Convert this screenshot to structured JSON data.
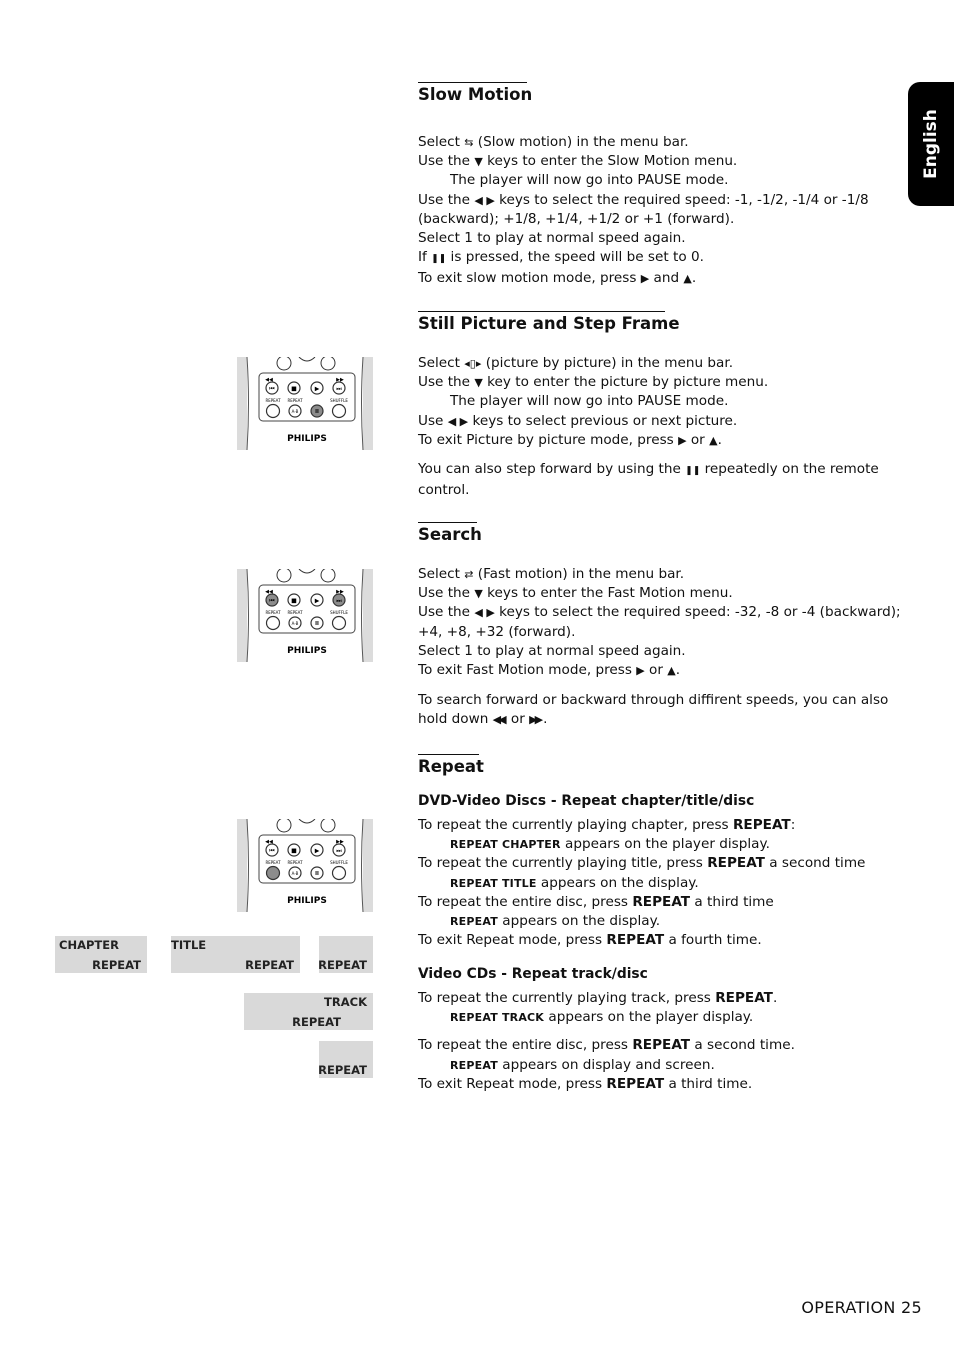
{
  "side_tab": {
    "label": "English"
  },
  "footer": {
    "label": "OPERATION 25"
  },
  "slow_motion": {
    "title": "Slow Motion",
    "lines": [
      {
        "pre": "Select ",
        "icon": "slow-motion-icon",
        "post": " (Slow motion) in the menu bar."
      },
      {
        "pre": "Use the ",
        "icon": "down-arrow-icon",
        "post": " keys to enter the Slow Motion menu."
      },
      {
        "text": "The player will now go into PAUSE mode.",
        "indent": true
      },
      {
        "pre": "Use the ",
        "icon": "left-right-arrows-icon",
        "post": " keys to select the required speed: -1, -1/2, -1/4 or -1/8 (backward); +1/8, +1/4, +1/2 or +1 (forward)."
      },
      {
        "text": "Select 1 to play at normal speed again."
      },
      {
        "pre": "If ",
        "icon": "pause-icon",
        "post": " is pressed, the speed will be set to 0."
      },
      {
        "pre": "To exit slow motion mode, press ",
        "icon": "play-icon",
        "mid": " and ",
        "icon2": "up-arrow-icon",
        "post": "."
      }
    ]
  },
  "still_picture": {
    "title": "Still Picture and Step Frame",
    "lines": [
      {
        "pre": "Select ",
        "icon": "picture-by-picture-icon",
        "post": " (picture by picture) in the menu bar."
      },
      {
        "pre": "Use the ",
        "icon": "down-arrow-icon",
        "post": " key to enter the picture by picture menu."
      },
      {
        "text": "The player will now go into PAUSE mode.",
        "indent": true
      },
      {
        "pre": "Use ",
        "icon": "left-right-arrows-icon",
        "post": " keys to select previous or next picture."
      },
      {
        "pre": "To exit Picture by picture mode, press ",
        "icon": "play-icon",
        "mid": "  or ",
        "icon2": "up-arrow-icon",
        "post": "."
      }
    ],
    "note": {
      "pre": "You can also step forward by using the ",
      "icon": "pause-icon",
      "post": " repeatedly on the remote control."
    }
  },
  "search": {
    "title": "Search",
    "lines": [
      {
        "pre": "Select ",
        "icon": "fast-motion-icon",
        "post": " (Fast motion) in the menu bar."
      },
      {
        "pre": "Use the ",
        "icon": "down-arrow-icon",
        "post": " keys to enter the Fast Motion menu."
      },
      {
        "pre": "Use the ",
        "icon": "left-right-arrows-icon",
        "post": " keys to select the required speed: -32, -8 or -4 (backward); +4, +8, +32 (forward)."
      },
      {
        "text": "Select 1 to play at normal speed again."
      },
      {
        "pre": "To exit Fast Motion mode, press ",
        "icon": "play-icon",
        "mid": "  or ",
        "icon2": "up-arrow-icon",
        "post": "."
      }
    ],
    "note": {
      "pre": "To search forward or backward through diffirent speeds, you can also hold down ",
      "icon": "rewind-icon",
      "mid": " or ",
      "icon2": "fast-forward-icon",
      "post": "."
    }
  },
  "repeat": {
    "title": "Repeat",
    "dvd": {
      "subtitle": "DVD-Video Discs - Repeat chapter/title/disc",
      "lines": [
        {
          "pre": "To repeat the currently playing chapter, press ",
          "bold": "REPEAT",
          "post": ":"
        },
        {
          "sc": "REPEAT CHAPTER",
          "post": " appears on the player display.",
          "indent": true
        },
        {
          "pre": "To repeat the currently playing title, press ",
          "bold": "REPEAT",
          "post": " a second time"
        },
        {
          "sc": "REPEAT TITLE",
          "post": " appears on the display.",
          "indent": true
        },
        {
          "pre": "To repeat the entire disc, press ",
          "bold": "REPEAT",
          "post": " a third time"
        },
        {
          "sc": "REPEAT",
          "post": " appears on the display.",
          "indent": true
        },
        {
          "pre": "To exit Repeat mode, press ",
          "bold": "REPEAT",
          "post": " a fourth time."
        }
      ]
    },
    "vcd": {
      "subtitle": "Video CDs - Repeat track/disc",
      "lines": [
        {
          "pre": "To repeat the currently playing track, press ",
          "bold": "REPEAT",
          "post": "."
        },
        {
          "sc": "REPEAT TRACK",
          "post": " appears on the player display.",
          "indent": true
        },
        {
          "pre": "To repeat the entire disc, press ",
          "bold": "REPEAT",
          "post": " a second time."
        },
        {
          "sc": "REPEAT",
          "post": " appears on display and screen.",
          "indent": true
        },
        {
          "pre": "To exit Repeat mode, press ",
          "bold": "REPEAT",
          "post": " a third time."
        }
      ]
    },
    "displays": [
      {
        "top": "CHAPTER",
        "bottom": "REPEAT"
      },
      {
        "top": "TITLE",
        "bottom": "REPEAT"
      },
      {
        "top": "",
        "bottom": "REPEAT"
      },
      {
        "top": "TRACK",
        "bottom": "REPEAT"
      },
      {
        "top": "",
        "bottom": "REPEAT"
      }
    ]
  },
  "remote": {
    "brand": "PHILIPS",
    "labels": {
      "repeat": "REPEAT",
      "repeat_ab": "REPEAT",
      "shuffle": "SHUFFLE",
      "ab": "A-B"
    },
    "highlight_colors": {
      "pressed": "#8c8c8c"
    },
    "figures": [
      {
        "highlighted": [
          "pause"
        ]
      },
      {
        "highlighted": [
          "prev",
          "next"
        ]
      },
      {
        "highlighted": [
          "repeat"
        ]
      }
    ]
  }
}
